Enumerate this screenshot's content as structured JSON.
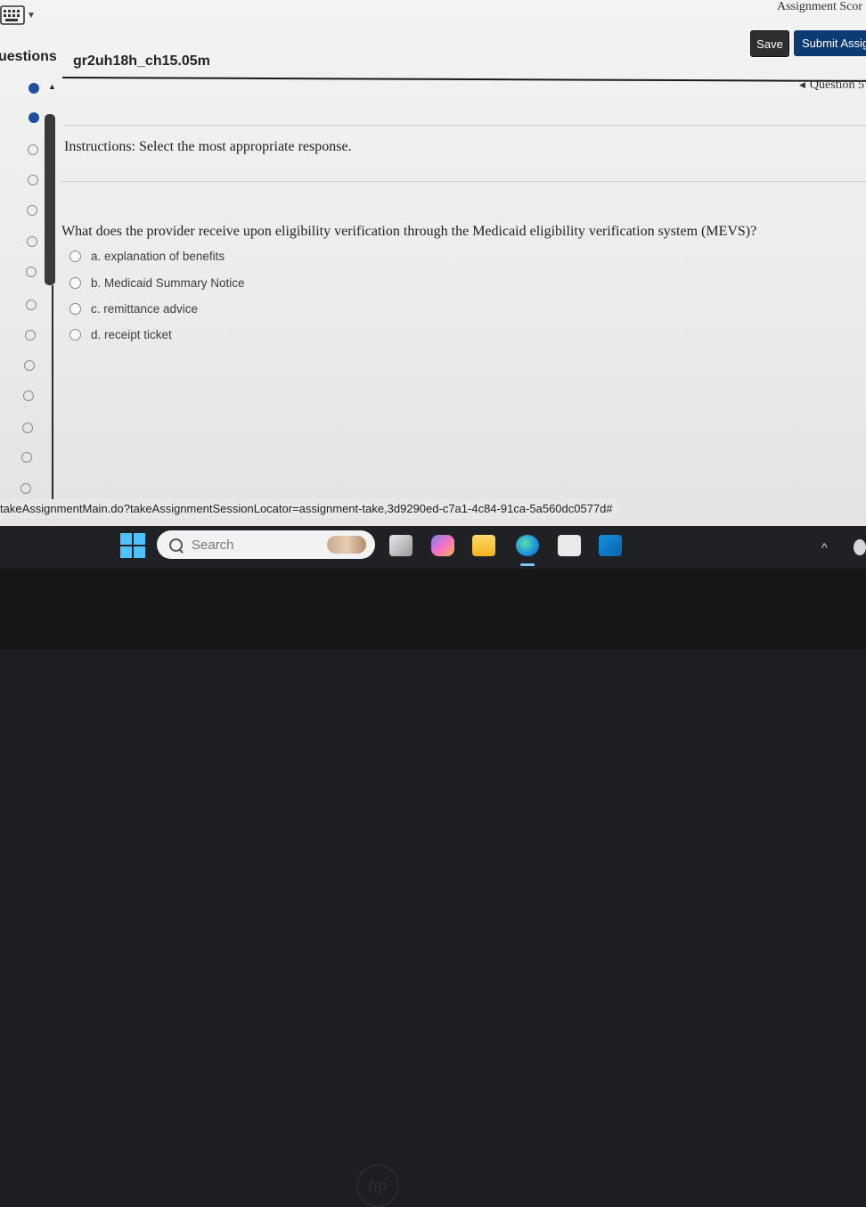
{
  "header": {
    "assignment_score_label": "Assignment Scor",
    "save_label": "Save",
    "submit_label": "Submit Assig",
    "questions_label": "uestions",
    "assignment_name": "gr2uh18h_ch15.05m",
    "question_nav_label": "Question 5"
  },
  "question_list": {
    "items": [
      {
        "state": "answered"
      },
      {
        "state": "answered"
      },
      {
        "state": "unanswered"
      },
      {
        "state": "unanswered"
      },
      {
        "state": "unanswered"
      },
      {
        "state": "unanswered"
      },
      {
        "state": "unanswered"
      },
      {
        "state": "unanswered"
      },
      {
        "state": "unanswered"
      },
      {
        "state": "unanswered"
      },
      {
        "state": "unanswered"
      },
      {
        "state": "unanswered"
      },
      {
        "state": "unanswered"
      },
      {
        "state": "unanswered"
      }
    ]
  },
  "content": {
    "instructions": "Instructions: Select the most appropriate response.",
    "question": "What does the provider receive upon eligibility verification through the Medicaid eligibility verification system (MEVS)?",
    "options": [
      "a. explanation of benefits",
      "b. Medicaid Summary Notice",
      "c. remittance advice",
      "d. receipt ticket"
    ]
  },
  "status_bar": {
    "url": "takeAssignmentMain.do?takeAssignmentSessionLocator=assignment-take,3d9290ed-c7a1-4c84-91ca-5a560dc0577d#"
  },
  "taskbar": {
    "search_placeholder": "Search",
    "icons": [
      "windows-start-icon",
      "copilot-icon",
      "teams-icon",
      "file-explorer-icon",
      "edge-icon",
      "microsoft-store-icon",
      "outlook-icon"
    ]
  },
  "colors": {
    "submit_button": "#0d3a73",
    "save_button": "#2e2e2e",
    "answered_dot": "#1f4f9c",
    "taskbar": "#202124"
  }
}
